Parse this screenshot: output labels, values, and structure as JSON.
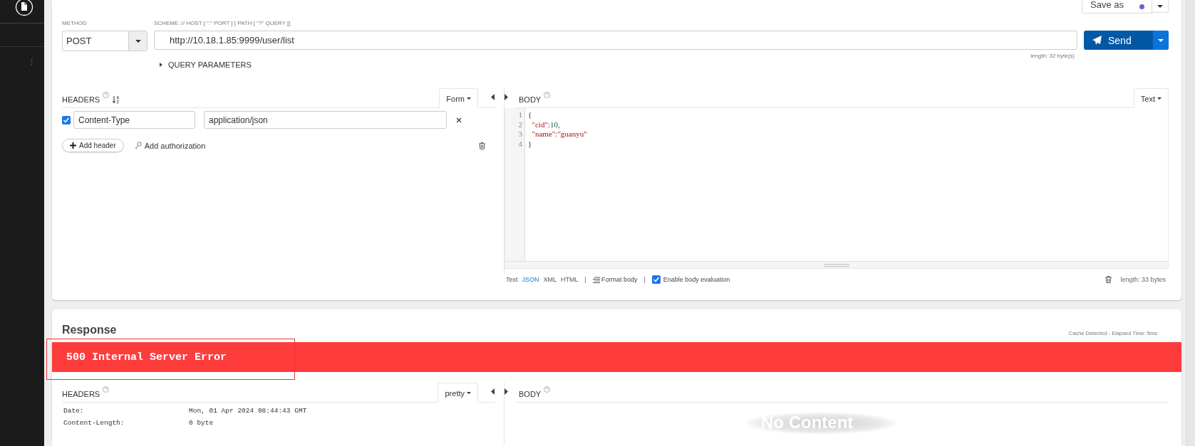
{
  "request": {
    "save_button": "Save as",
    "method": {
      "label": "METHOD",
      "value": "POST"
    },
    "url": {
      "label": "SCHEME :// HOST [ \":\" PORT ] [ PATH [ \"?\" QUERY ]]",
      "value": "http://10.18.1.85:9999/user/list",
      "length": "length: 32 byte(s)"
    },
    "send": "Send",
    "query_parameters": {
      "label": "QUERY PARAMETERS",
      "expanded": false
    },
    "headers": {
      "title": "HEADERS",
      "mode": "Form",
      "add_header": "Add header",
      "add_authorization": "Add authorization",
      "rows": [
        {
          "enabled": true,
          "name": "Content-Type",
          "value": "application/json"
        }
      ]
    },
    "body": {
      "title": "BODY",
      "mode": "Text",
      "lines": [
        {
          "number": "1",
          "tokens": [
            {
              "kind": "punct",
              "text": "{"
            }
          ]
        },
        {
          "number": "2",
          "tokens": [
            {
              "kind": "key",
              "text": "  \"cid\""
            },
            {
              "kind": "punct",
              "text": ":"
            },
            {
              "kind": "number",
              "text": "10"
            },
            {
              "kind": "punct",
              "text": ","
            }
          ]
        },
        {
          "number": "3",
          "tokens": [
            {
              "kind": "key",
              "text": "  \"name\""
            },
            {
              "kind": "punct",
              "text": ":"
            },
            {
              "kind": "string",
              "text": "\"guanyu\""
            }
          ]
        },
        {
          "number": "4",
          "tokens": [
            {
              "kind": "punct",
              "text": "}"
            }
          ]
        }
      ],
      "formats": [
        {
          "label": "Text",
          "selected": false
        },
        {
          "label": "JSON",
          "selected": true
        },
        {
          "label": "XML",
          "selected": false
        },
        {
          "label": "HTML",
          "selected": false
        }
      ],
      "separators": [
        "|",
        "|"
      ],
      "format_body": "Format body",
      "evaluation": {
        "label": "Enable body evaluation",
        "checked": true
      },
      "length": "length: 33 bytes"
    }
  },
  "response": {
    "title": "Response",
    "timing": "Cache Detected - Elapsed Time: 5ms",
    "status": "500 Internal Server Error",
    "headers": {
      "title": "HEADERS",
      "mode": "pretty",
      "rows": [
        {
          "name": "Date:",
          "value": "Mon, 01 Apr 2024 08:44:43 GMT"
        },
        {
          "name": "Content-Length:",
          "value": "0 byte"
        }
      ]
    },
    "body": {
      "title": "BODY",
      "placeholder": "No Content"
    }
  }
}
